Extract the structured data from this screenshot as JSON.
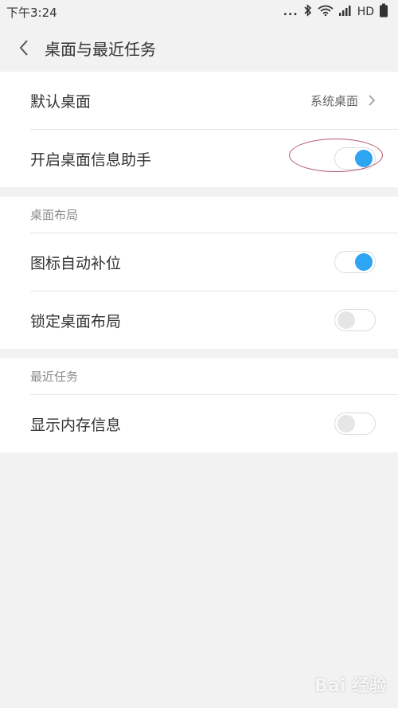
{
  "status": {
    "time": "下午3:24",
    "dots": "...",
    "network": "HD"
  },
  "header": {
    "title": "桌面与最近任务"
  },
  "settings": {
    "default_desktop_label": "默认桌面",
    "default_desktop_value": "系统桌面",
    "assistant_label": "开启桌面信息助手",
    "assistant_on": true
  },
  "layout_section": {
    "header": "桌面布局",
    "auto_fill_label": "图标自动补位",
    "auto_fill_on": true,
    "lock_layout_label": "锁定桌面布局",
    "lock_layout_on": false
  },
  "recent_section": {
    "header": "最近任务",
    "memory_label": "显示内存信息",
    "memory_on": false
  },
  "watermark": "Bai 经验",
  "colors": {
    "accent": "#2da5f2",
    "background": "#f2f2f2",
    "annotation": "#b5556b"
  }
}
